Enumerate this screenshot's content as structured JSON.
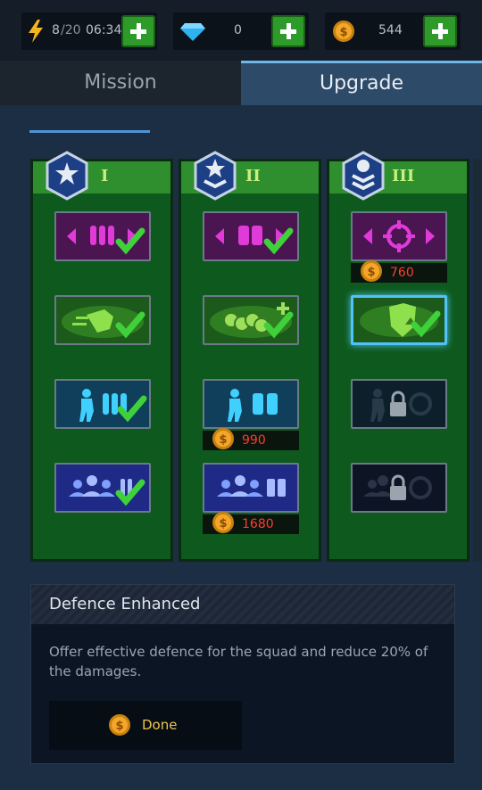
{
  "topbar": {
    "energy": {
      "icon": "lightning-icon",
      "current": "8",
      "max": "/20",
      "timer": "06:34"
    },
    "gems": {
      "icon": "diamond-icon",
      "value": "0"
    },
    "coins": {
      "icon": "coin-icon",
      "value": "544"
    },
    "plus_icon": "plus-icon"
  },
  "tabs": [
    {
      "label": "Mission",
      "active": false
    },
    {
      "label": "Upgrade",
      "active": true
    }
  ],
  "tiers": [
    {
      "numeral": "I",
      "items": [
        {
          "icon": "ammo-expand-icon",
          "status": "done"
        },
        {
          "icon": "speed-boost-icon",
          "status": "done"
        },
        {
          "icon": "soldier-ammo-icon",
          "status": "done"
        },
        {
          "icon": "squad-ammo-icon",
          "status": "done"
        }
      ]
    },
    {
      "numeral": "II",
      "items": [
        {
          "icon": "magazine-expand-icon",
          "status": "done"
        },
        {
          "icon": "coins-plus-icon",
          "status": "done"
        },
        {
          "icon": "soldier-magazine-icon",
          "status": "available",
          "cost": "990"
        },
        {
          "icon": "squad-magazine-icon",
          "status": "available",
          "cost": "1680"
        }
      ]
    },
    {
      "numeral": "III",
      "items": [
        {
          "icon": "crosshair-expand-icon",
          "status": "available",
          "cost": "760"
        },
        {
          "icon": "shield-upgrade-icon",
          "status": "done",
          "selected": true
        },
        {
          "icon": "soldier-crosshair-icon",
          "status": "locked"
        },
        {
          "icon": "squad-crosshair-icon",
          "status": "locked"
        }
      ]
    }
  ],
  "detail": {
    "title": "Defence Enhanced",
    "description": "Offer effective defence for the squad and reduce 20% of the damages.",
    "button_label": "Done"
  },
  "colors": {
    "accent_blue": "#4d95d6",
    "cost_red": "#ff3b30",
    "tier_green": "#0e5a1e",
    "check_green": "#3fd13a",
    "gold": "#f0c44a"
  }
}
